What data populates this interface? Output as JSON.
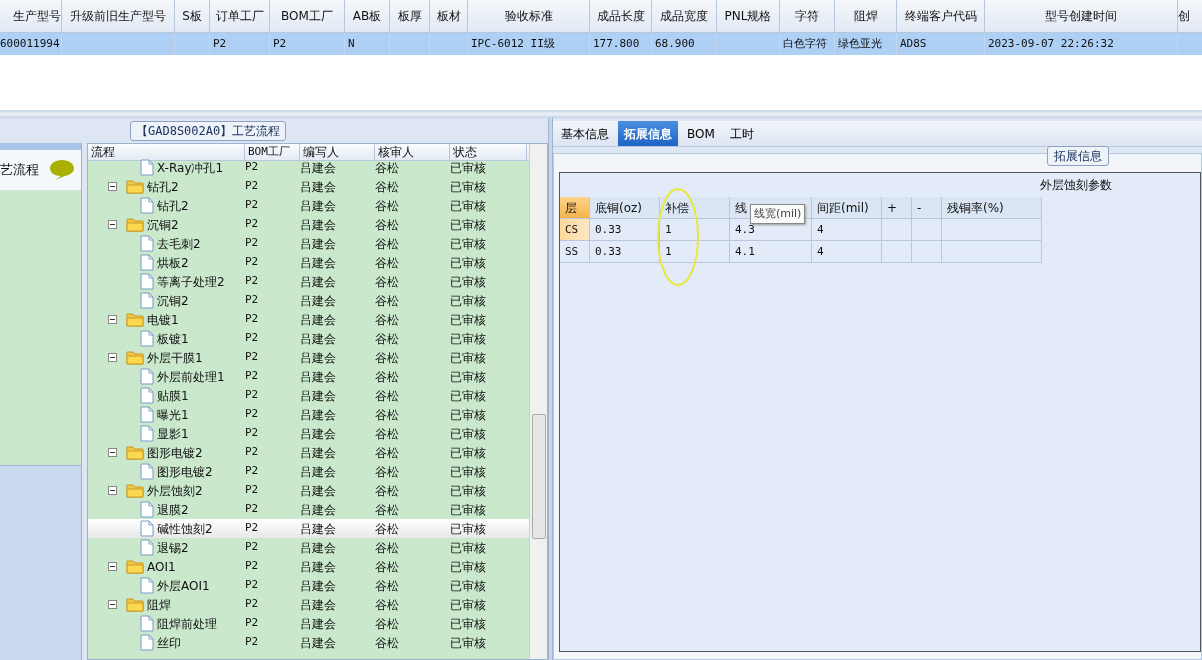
{
  "model_grid": {
    "columns": [
      "生产型号",
      "升级前旧生产型号",
      "S板",
      "订单工厂",
      "BOM工厂",
      "AB板",
      "板厚",
      "板材",
      "验收标准",
      "成品长度",
      "成品宽度",
      "PNL规格",
      "字符",
      "阻焊",
      "终端客户代码",
      "型号创建时间",
      "创"
    ],
    "rows": [
      {
        "selected": true,
        "cells": [
          "600011994",
          null,
          null,
          "P2",
          "P2",
          "N",
          null,
          null,
          "IPC-6012 II级",
          "177.800",
          "68.900",
          null,
          "白色字符",
          "绿色亚光",
          "AD8S",
          "2023-09-07 22:26:32",
          null
        ]
      }
    ]
  },
  "left_panel": {
    "title": "艺流程"
  },
  "flow": {
    "title": "【GAD8S002A0】工艺流程",
    "columns": [
      "流程",
      "BOM工厂",
      "编写人",
      "核审人",
      "状态"
    ],
    "rows": [
      {
        "kind": "file",
        "label": "X-Ray冲孔1",
        "bom": "P2",
        "writer": "吕建会",
        "reviewer": "谷松",
        "status": "已审核",
        "selected": false
      },
      {
        "kind": "folder",
        "label": "钻孔2",
        "bom": "P2",
        "writer": "吕建会",
        "reviewer": "谷松",
        "status": "已审核",
        "selected": false,
        "expanded": true,
        "children": [
          {
            "kind": "file",
            "label": "钻孔2",
            "bom": "P2",
            "writer": "吕建会",
            "reviewer": "谷松",
            "status": "已审核",
            "selected": false
          }
        ]
      },
      {
        "kind": "folder",
        "label": "沉铜2",
        "bom": "P2",
        "writer": "吕建会",
        "reviewer": "谷松",
        "status": "已审核",
        "selected": false,
        "expanded": true,
        "children": [
          {
            "kind": "file",
            "label": "去毛刺2",
            "bom": "P2",
            "writer": "吕建会",
            "reviewer": "谷松",
            "status": "已审核",
            "selected": false
          },
          {
            "kind": "file",
            "label": "烘板2",
            "bom": "P2",
            "writer": "吕建会",
            "reviewer": "谷松",
            "status": "已审核",
            "selected": false
          },
          {
            "kind": "file",
            "label": "等离子处理2",
            "bom": "P2",
            "writer": "吕建会",
            "reviewer": "谷松",
            "status": "已审核",
            "selected": false
          },
          {
            "kind": "file",
            "label": "沉铜2",
            "bom": "P2",
            "writer": "吕建会",
            "reviewer": "谷松",
            "status": "已审核",
            "selected": false
          }
        ]
      },
      {
        "kind": "folder",
        "label": "电镀1",
        "bom": "P2",
        "writer": "吕建会",
        "reviewer": "谷松",
        "status": "已审核",
        "selected": false,
        "expanded": true,
        "children": [
          {
            "kind": "file",
            "label": "板镀1",
            "bom": "P2",
            "writer": "吕建会",
            "reviewer": "谷松",
            "status": "已审核",
            "selected": false
          }
        ]
      },
      {
        "kind": "folder",
        "label": "外层干膜1",
        "bom": "P2",
        "writer": "吕建会",
        "reviewer": "谷松",
        "status": "已审核",
        "selected": false,
        "expanded": true,
        "children": [
          {
            "kind": "file",
            "label": "外层前处理1",
            "bom": "P2",
            "writer": "吕建会",
            "reviewer": "谷松",
            "status": "已审核",
            "selected": false
          },
          {
            "kind": "file",
            "label": "贴膜1",
            "bom": "P2",
            "writer": "吕建会",
            "reviewer": "谷松",
            "status": "已审核",
            "selected": false
          },
          {
            "kind": "file",
            "label": "曝光1",
            "bom": "P2",
            "writer": "吕建会",
            "reviewer": "谷松",
            "status": "已审核",
            "selected": false
          },
          {
            "kind": "file",
            "label": "显影1",
            "bom": "P2",
            "writer": "吕建会",
            "reviewer": "谷松",
            "status": "已审核",
            "selected": false
          }
        ]
      },
      {
        "kind": "folder",
        "label": "图形电镀2",
        "bom": "P2",
        "writer": "吕建会",
        "reviewer": "谷松",
        "status": "已审核",
        "selected": false,
        "expanded": true,
        "children": [
          {
            "kind": "file",
            "label": "图形电镀2",
            "bom": "P2",
            "writer": "吕建会",
            "reviewer": "谷松",
            "status": "已审核",
            "selected": false
          }
        ]
      },
      {
        "kind": "folder",
        "label": "外层蚀刻2",
        "bom": "P2",
        "writer": "吕建会",
        "reviewer": "谷松",
        "status": "已审核",
        "selected": false,
        "expanded": true,
        "children": [
          {
            "kind": "file",
            "label": "退膜2",
            "bom": "P2",
            "writer": "吕建会",
            "reviewer": "谷松",
            "status": "已审核",
            "selected": false
          },
          {
            "kind": "file",
            "label": "碱性蚀刻2",
            "bom": "P2",
            "writer": "吕建会",
            "reviewer": "谷松",
            "status": "已审核",
            "selected": true
          },
          {
            "kind": "file",
            "label": "退锡2",
            "bom": "P2",
            "writer": "吕建会",
            "reviewer": "谷松",
            "status": "已审核",
            "selected": false
          }
        ]
      },
      {
        "kind": "folder",
        "label": "AOI1",
        "bom": "P2",
        "writer": "吕建会",
        "reviewer": "谷松",
        "status": "已审核",
        "selected": false,
        "expanded": true,
        "children": [
          {
            "kind": "file",
            "label": "外层AOI1",
            "bom": "P2",
            "writer": "吕建会",
            "reviewer": "谷松",
            "status": "已审核",
            "selected": false
          }
        ]
      },
      {
        "kind": "folder",
        "label": "阻焊",
        "bom": "P2",
        "writer": "吕建会",
        "reviewer": "谷松",
        "status": "已审核",
        "selected": false,
        "expanded": true,
        "children": [
          {
            "kind": "file",
            "label": "阻焊前处理",
            "bom": "P2",
            "writer": "吕建会",
            "reviewer": "谷松",
            "status": "已审核",
            "selected": false
          },
          {
            "kind": "file",
            "label": "丝印",
            "bom": "P2",
            "writer": "吕建会",
            "reviewer": "谷松",
            "status": "已审核",
            "selected": false
          }
        ]
      }
    ]
  },
  "detail_tabs": [
    {
      "label": "基本信息",
      "selected": false
    },
    {
      "label": "拓展信息",
      "selected": true
    },
    {
      "label": "BOM",
      "selected": false
    },
    {
      "label": "工时",
      "selected": false
    }
  ],
  "extended_info": {
    "title": "拓展信息",
    "table_title": "外层蚀刻参数",
    "columns": [
      "层",
      "底铜(oz)",
      "补偿",
      "线",
      "间距(mil)",
      "+",
      "-",
      "残铜率(%)"
    ],
    "rows": [
      {
        "selected": true,
        "cells": [
          "CS",
          "0.33",
          "1",
          "4.3",
          "4",
          null,
          null,
          null
        ]
      },
      {
        "selected": false,
        "cells": [
          "SS",
          "0.33",
          "1",
          "4.1",
          "4",
          null,
          null,
          null
        ]
      }
    ],
    "tooltip": "线宽(mil)"
  }
}
